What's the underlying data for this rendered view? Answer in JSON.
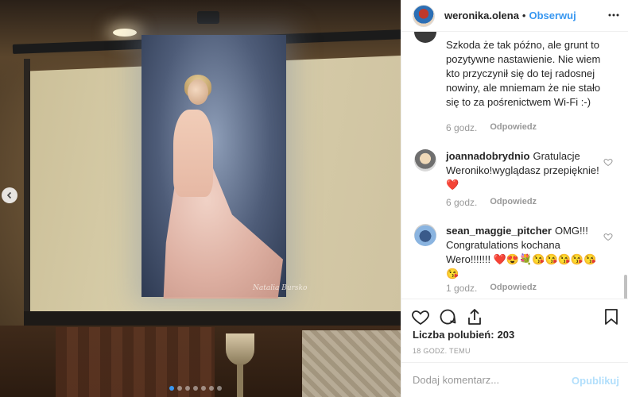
{
  "post": {
    "username": "weronika.olena",
    "separator": "•",
    "follow_label": "Obserwuj"
  },
  "comments": {
    "c1": {
      "text": "Szkoda że tak późno, ale grunt to pozytywne nastawienie. Nie wiem kto przyczynił się do tej radosnej nowiny, ale mniemam że nie stało się to za pośrenictwem Wi-Fi :-)",
      "time": "6 godz.",
      "reply": "Odpowiedz"
    },
    "c2": {
      "username": "joannadobrydnio",
      "text": "Gratulacje Weroniko!wyglądasz przepięknie!",
      "emoji": "❤️",
      "time": "6 godz.",
      "reply": "Odpowiedz"
    },
    "c3": {
      "username": "sean_maggie_pitcher",
      "text": "OMG!!! Congratulations kochana Wero!!!!!!!",
      "emoji": "❤️😍💐😘😘😘😘😘😘",
      "time": "1 godz.",
      "reply": "Odpowiedz"
    }
  },
  "likes": {
    "label": "Liczba polubień:",
    "count": "203"
  },
  "time_ago": "18 GODZ. TEMU",
  "composer": {
    "placeholder": "Dodaj komentarz...",
    "publish_label": "Opublikuj"
  },
  "photo": {
    "signature": "Natalia Bursko",
    "carousel": {
      "count": 7,
      "active_index": 0
    }
  },
  "colors": {
    "accent": "#3897f0",
    "publish_disabled": "#b2dffc",
    "muted": "#999999",
    "heart": "#e0245e"
  },
  "icons": [
    "chevron-left-icon",
    "more-horizontal-icon",
    "heart-icon",
    "comment-icon",
    "share-icon",
    "bookmark-icon"
  ]
}
